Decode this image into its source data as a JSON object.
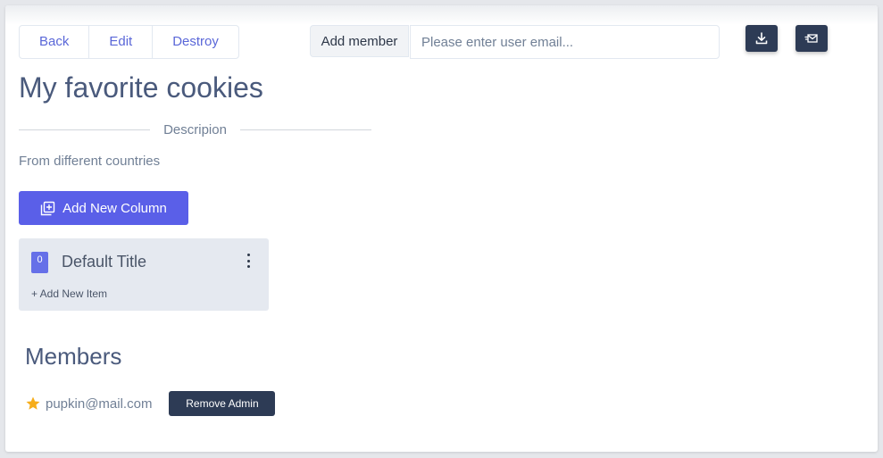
{
  "toolbar": {
    "back_label": "Back",
    "edit_label": "Edit",
    "destroy_label": "Destroy",
    "add_member_label": "Add member",
    "email_placeholder": "Please enter user email..."
  },
  "icons": {
    "download": "download-icon",
    "mail": "mail-send-icon",
    "add_column": "add-column-icon",
    "star": "star-icon",
    "menu": "more-vertical-icon"
  },
  "board": {
    "title": "My favorite cookies",
    "description_label": "Descripion",
    "description": "From different countries",
    "add_column_label": "Add New Column"
  },
  "columns": [
    {
      "count": "0",
      "title": "Default Title",
      "add_item_label": "+ Add New Item"
    }
  ],
  "members": {
    "title": "Members",
    "list": [
      {
        "email": "pupkin@mail.com",
        "action_label": "Remove Admin"
      }
    ]
  },
  "colors": {
    "accent": "#5a5fe8",
    "dark_button": "#2d3b55",
    "star": "#f6ad1b",
    "link": "#5a67d8"
  }
}
